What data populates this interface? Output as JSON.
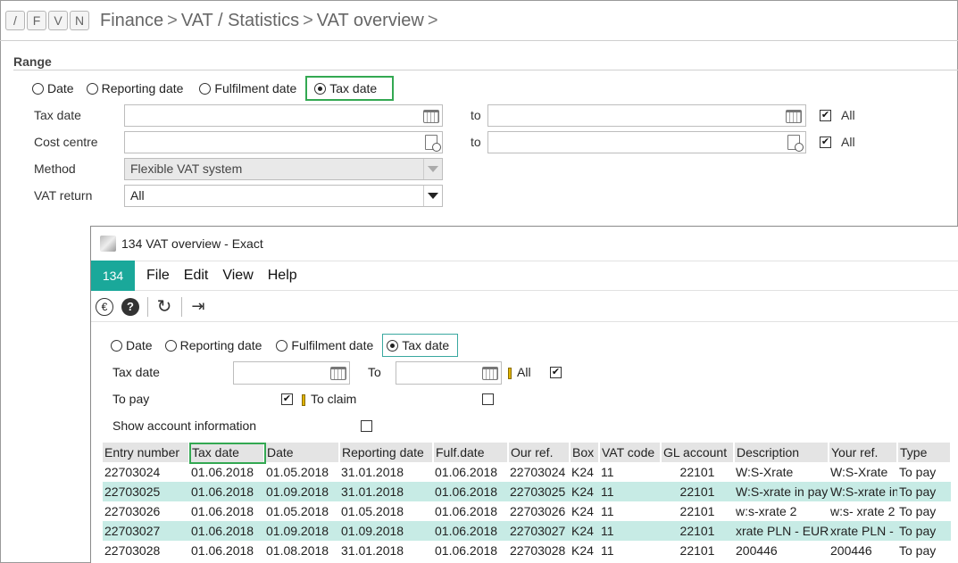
{
  "header": {
    "key_buttons": [
      "/",
      "F",
      "V",
      "N"
    ],
    "breadcrumb": [
      "Finance",
      "VAT / Statistics",
      "VAT overview"
    ],
    "separator": ">"
  },
  "range": {
    "title": "Range",
    "radios": [
      {
        "label": "Date",
        "selected": false
      },
      {
        "label": "Reporting date",
        "selected": false
      },
      {
        "label": "Fulfilment date",
        "selected": false
      },
      {
        "label": "Tax date",
        "selected": true
      }
    ]
  },
  "form": {
    "tax_date_label": "Tax date",
    "cost_centre_label": "Cost centre",
    "method_label": "Method",
    "method_value": "Flexible VAT system",
    "vat_return_label": "VAT return",
    "vat_return_value": "All",
    "to_label": "to",
    "all_label": "All",
    "tax_date_all_checked": true,
    "cost_centre_all_checked": true
  },
  "window": {
    "title": "134 VAT overview - Exact",
    "menu_number": "134",
    "menu": [
      "File",
      "Edit",
      "View",
      "Help"
    ],
    "toolbar_icons": [
      "euro-icon",
      "help-icon",
      "refresh-icon",
      "exit-icon"
    ],
    "radios": [
      {
        "label": "Date",
        "selected": false
      },
      {
        "label": "Reporting date",
        "selected": false
      },
      {
        "label": "Fulfilment date",
        "selected": false
      },
      {
        "label": "Tax date",
        "selected": true
      }
    ],
    "tax_date_label": "Tax date",
    "to_label": "To",
    "all_label": "All",
    "all_checked": true,
    "to_pay_label": "To pay",
    "to_pay_checked": true,
    "to_claim_label": "To claim",
    "to_claim_checked": false,
    "show_account_label": "Show account information",
    "show_account_checked": false
  },
  "table": {
    "columns": [
      "Entry number",
      "Tax date",
      "Date",
      "Reporting date",
      "Fulf.date",
      "Our ref.",
      "Box",
      "VAT code",
      "GL account",
      "Description",
      "Your ref.",
      "Type"
    ],
    "rows": [
      [
        "22703024",
        "01.06.2018",
        "01.05.2018",
        "31.01.2018",
        "01.06.2018",
        "22703024",
        "K24",
        "11",
        "22101",
        "W:S-Xrate",
        "W:S-Xrate",
        "To pay"
      ],
      [
        "22703025",
        "01.06.2018",
        "01.09.2018",
        "31.01.2018",
        "01.06.2018",
        "22703025",
        "K24",
        "11",
        "22101",
        "W:S-xrate in pay",
        "W:S-xrate in",
        "To pay"
      ],
      [
        "22703026",
        "01.06.2018",
        "01.05.2018",
        "01.05.2018",
        "01.06.2018",
        "22703026",
        "K24",
        "11",
        "22101",
        "w:s-xrate 2",
        "w:s- xrate 2",
        "To pay"
      ],
      [
        "22703027",
        "01.06.2018",
        "01.09.2018",
        "01.09.2018",
        "01.06.2018",
        "22703027",
        "K24",
        "11",
        "22101",
        "xrate PLN - EUR",
        "xrate PLN -",
        "To pay"
      ],
      [
        "22703028",
        "01.06.2018",
        "01.08.2018",
        "31.01.2018",
        "01.06.2018",
        "22703028",
        "K24",
        "11",
        "22101",
        "200446",
        "200446",
        "To pay"
      ]
    ]
  }
}
